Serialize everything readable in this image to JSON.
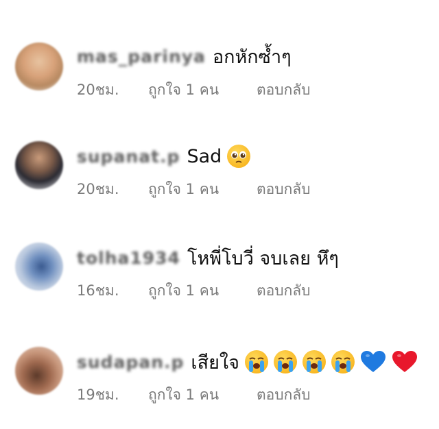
{
  "comments": [
    {
      "username": "mas_parinya",
      "text": "อกหักซ้ำๆ",
      "emojis": [],
      "time": "20ชม.",
      "likes": "ถูกใจ 1 คน",
      "reply": "ตอบกลับ"
    },
    {
      "username": "supanat.p",
      "text": "Sad",
      "emojis": [
        "pleading-face"
      ],
      "time": "20ชม.",
      "likes": "ถูกใจ 1 คน",
      "reply": "ตอบกลับ"
    },
    {
      "username": "tolha1934",
      "text": "โหพี่โบวี่ จบเลย หึๆ",
      "emojis": [],
      "time": "16ชม.",
      "likes": "ถูกใจ 1 คน",
      "reply": "ตอบกลับ"
    },
    {
      "username": "sudapan.p",
      "text": "เสียใจ",
      "emojis": [
        "loudly-crying-face",
        "loudly-crying-face",
        "loudly-crying-face",
        "loudly-crying-face",
        "blue-heart",
        "red-heart"
      ],
      "time": "19ชม.",
      "likes": "ถูกใจ 1 คน",
      "reply": "ตอบกลับ"
    }
  ],
  "colors": {
    "meta_text": "#7a7a7a",
    "blue_heart": "#1f7ae0",
    "red_heart": "#e8182c",
    "emoji_yellow": "#f8b621"
  }
}
